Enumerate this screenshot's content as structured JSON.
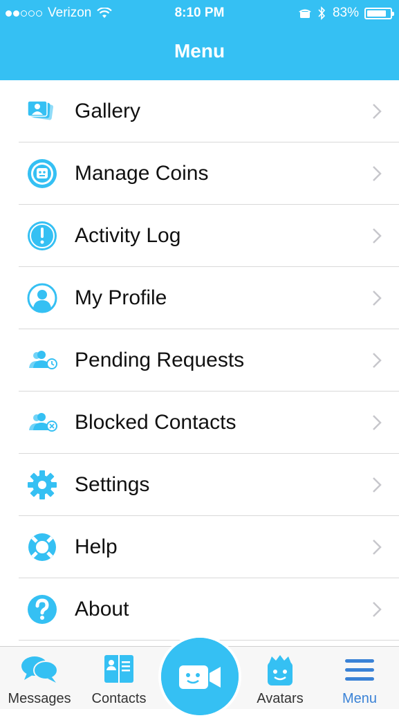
{
  "status_bar": {
    "carrier": "Verizon",
    "time": "8:10 PM",
    "battery": "83%",
    "battery_level": 0.83
  },
  "header": {
    "title": "Menu"
  },
  "menu": {
    "items": [
      {
        "label": "Gallery",
        "icon": "gallery-icon"
      },
      {
        "label": "Manage Coins",
        "icon": "coins-icon"
      },
      {
        "label": "Activity Log",
        "icon": "alert-icon"
      },
      {
        "label": "My Profile",
        "icon": "profile-icon"
      },
      {
        "label": "Pending Requests",
        "icon": "pending-requests-icon"
      },
      {
        "label": "Blocked Contacts",
        "icon": "blocked-contacts-icon"
      },
      {
        "label": "Settings",
        "icon": "gear-icon"
      },
      {
        "label": "Help",
        "icon": "lifebuoy-icon"
      },
      {
        "label": "About",
        "icon": "question-icon"
      }
    ]
  },
  "tabbar": {
    "tabs": [
      {
        "label": "Messages",
        "icon": "chat-bubbles-icon"
      },
      {
        "label": "Contacts",
        "icon": "contacts-book-icon"
      },
      {
        "label": "Avatars",
        "icon": "avatar-face-icon"
      },
      {
        "label": "Menu",
        "icon": "hamburger-icon",
        "active": true
      }
    ],
    "center_button_icon": "video-camera-icon"
  },
  "colors": {
    "accent": "#35c0f3",
    "active_tab": "#3a82d6",
    "chevron": "#c7c7cc"
  }
}
